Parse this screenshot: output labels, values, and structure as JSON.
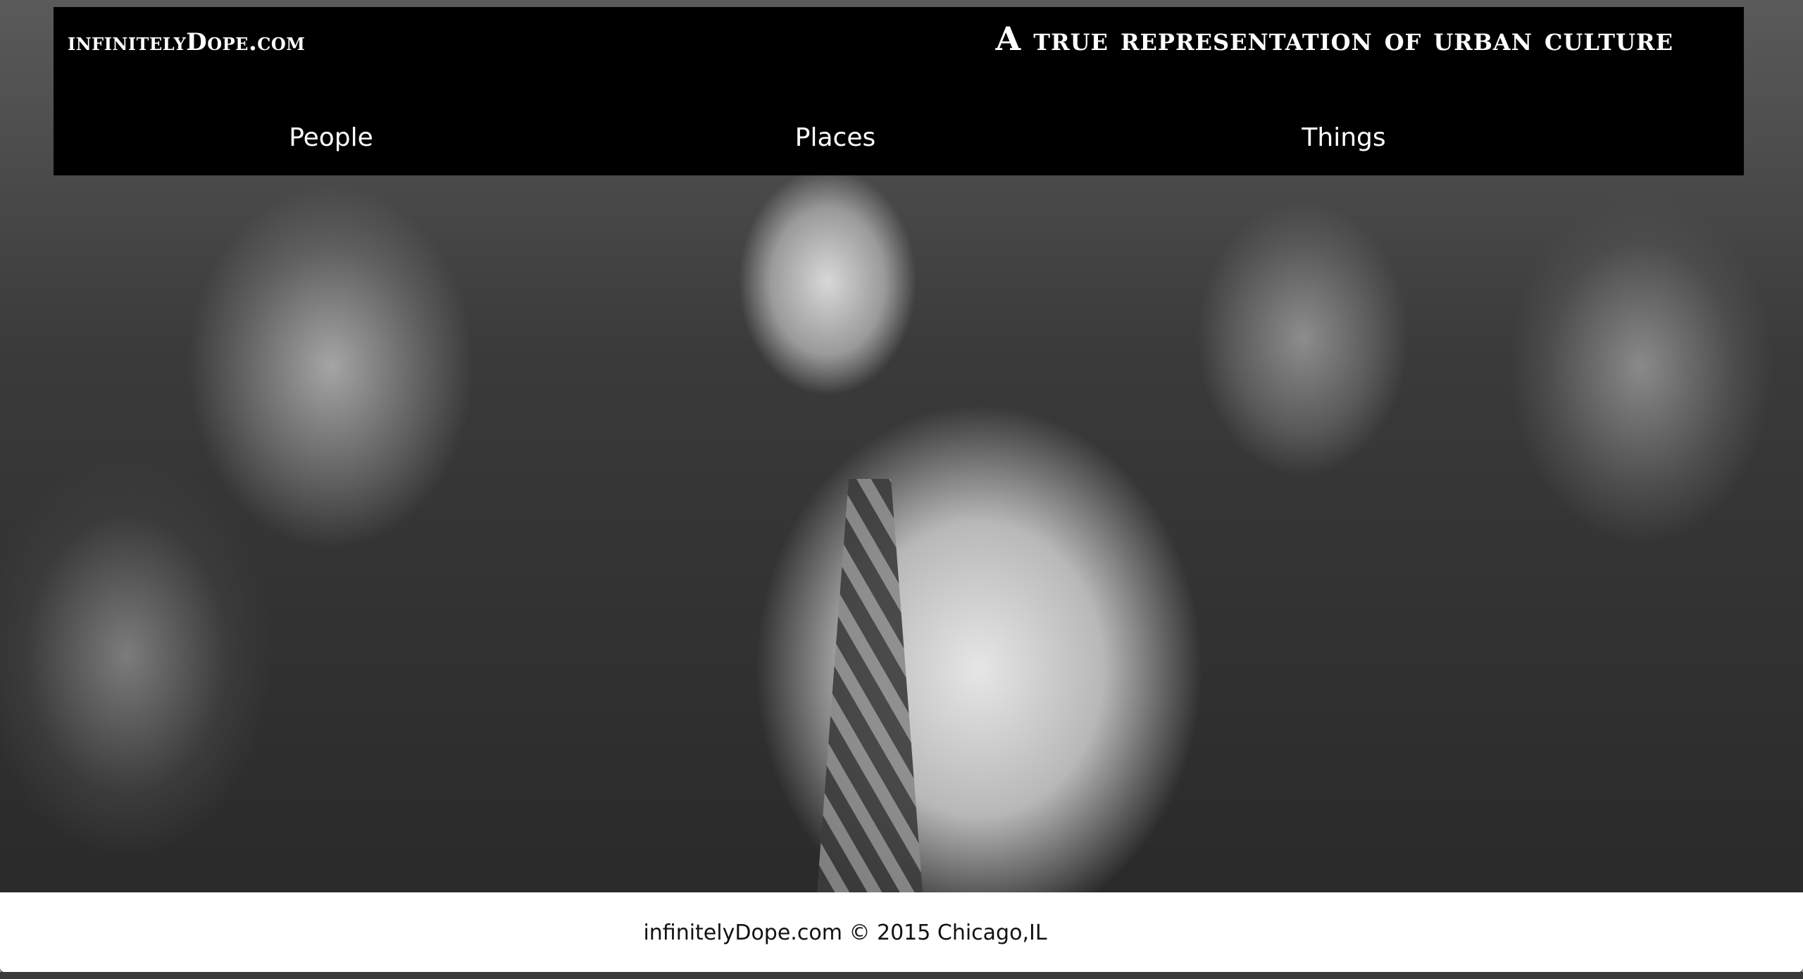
{
  "header": {
    "site_title": "infinitelyDope.com",
    "tagline": "A true representation of urban culture"
  },
  "nav": {
    "items": [
      {
        "label": "People"
      },
      {
        "label": "Places"
      },
      {
        "label": "Things"
      }
    ]
  },
  "footer": {
    "text": "infinitelyDope.com © 2015 Chicago,IL"
  }
}
